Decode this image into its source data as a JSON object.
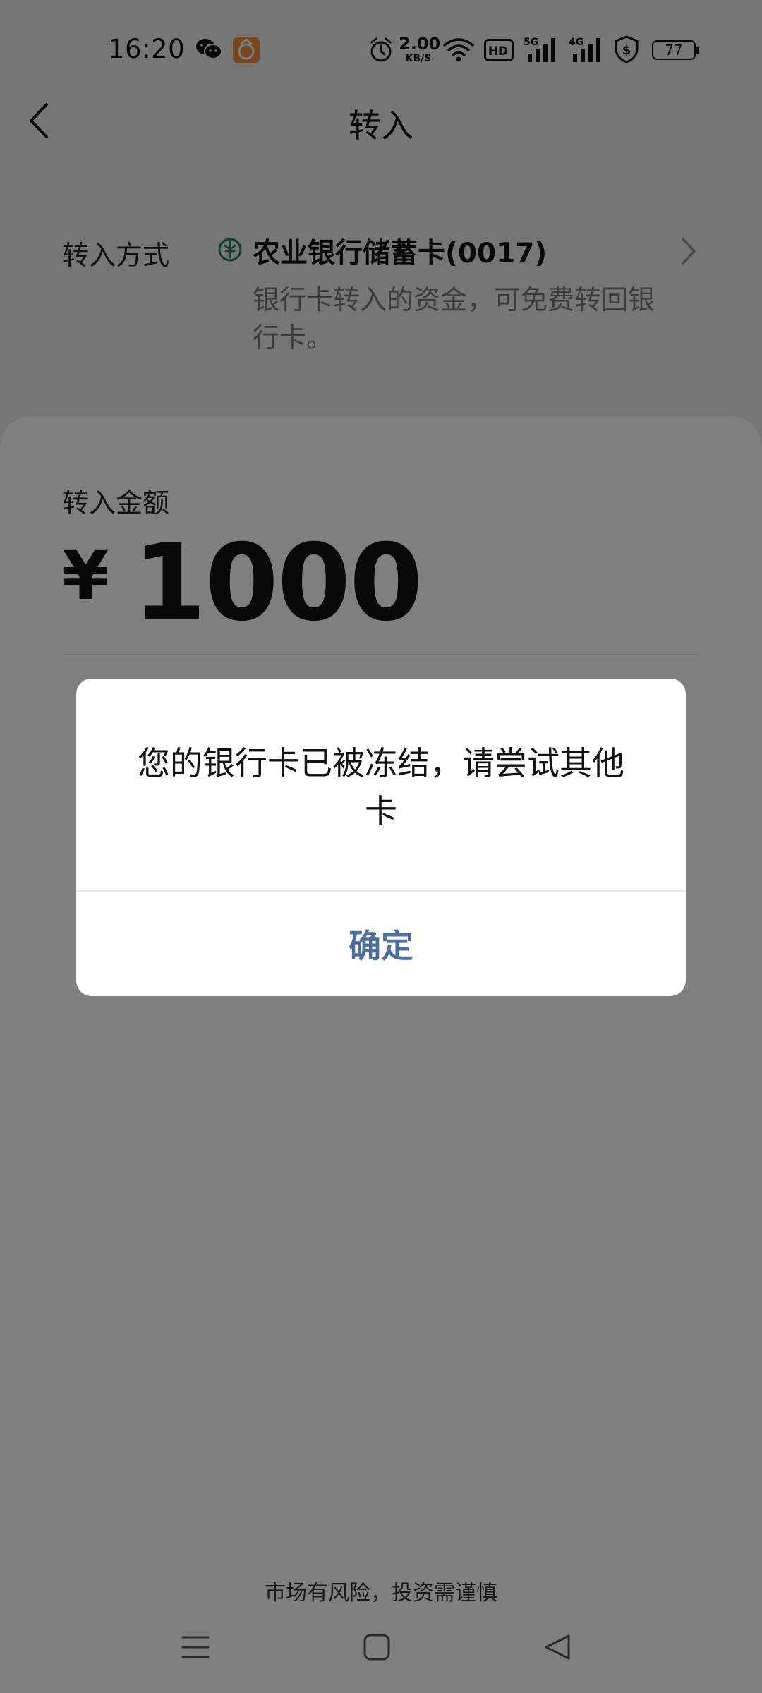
{
  "status_bar": {
    "time": "16:20",
    "network_speed_value": "2.00",
    "network_speed_unit": "KB/S",
    "hd_label": "HD",
    "signal_5g_label": "5G",
    "signal_4g_label": "4G",
    "battery_level": "77",
    "icons": [
      "wechat-icon",
      "app-icon",
      "alarm-icon",
      "wifi-icon",
      "hd-icon",
      "signal-5g-icon",
      "signal-4g-icon",
      "shield-dollar-icon",
      "battery-icon"
    ]
  },
  "header": {
    "title": "转入",
    "back_icon": "chevron-left-icon"
  },
  "transfer_method": {
    "label": "转入方式",
    "bank_name": "农业银行储蓄卡(0017)",
    "note": "银行卡转入的资金，可免费转回银行卡。",
    "bank_logo_icon": "abc-bank-logo-icon",
    "bank_logo_color": "#1a7a5a"
  },
  "amount": {
    "label": "转入金额",
    "currency": "¥",
    "value": "1000"
  },
  "footer": {
    "risk_notice": "市场有风险，投资需谨慎"
  },
  "dialog": {
    "message": "您的银行卡已被冻结，请尝试其他卡",
    "confirm_label": "确定",
    "confirm_color": "#4f6ea0"
  },
  "nav_bar": {
    "icons": [
      "menu-icon",
      "home-icon",
      "back-icon"
    ]
  }
}
